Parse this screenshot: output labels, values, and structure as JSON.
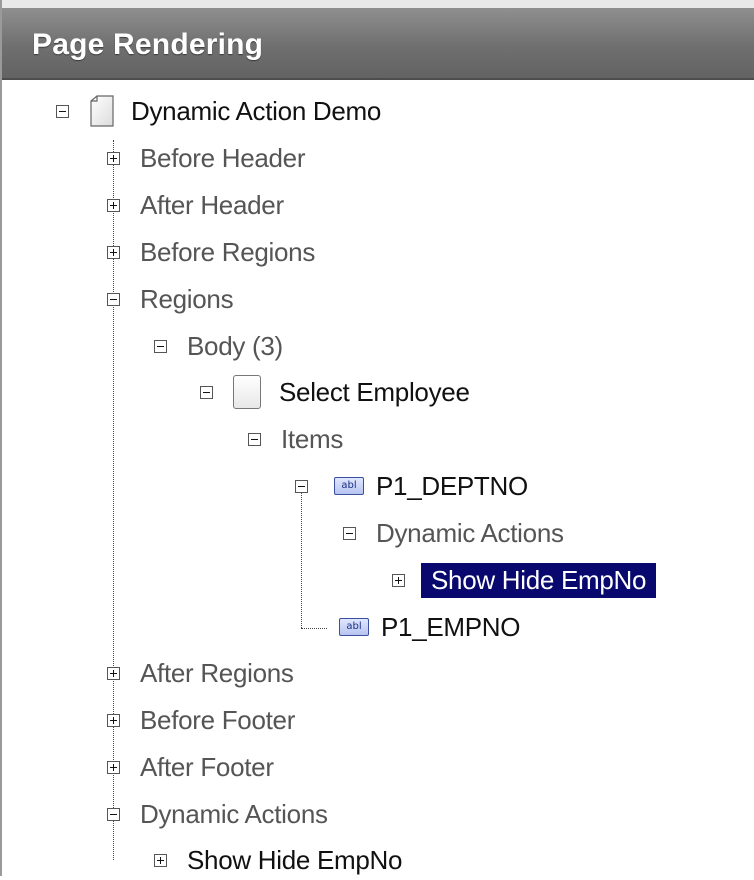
{
  "panel": {
    "title": "Page Rendering"
  },
  "tree": {
    "page": "Dynamic Action Demo",
    "before_header": "Before Header",
    "after_header": "After Header",
    "before_regions": "Before Regions",
    "regions": "Regions",
    "body": "Body (3)",
    "select_employee": "Select Employee",
    "items": "Items",
    "item_icon_text": "abl",
    "p1_deptno": "P1_DEPTNO",
    "item_dynamic_actions": "Dynamic Actions",
    "item_show_hide": "Show Hide EmpNo",
    "p1_empno": "P1_EMPNO",
    "after_regions": "After Regions",
    "before_footer": "Before Footer",
    "after_footer": "After Footer",
    "dynamic_actions": "Dynamic Actions",
    "show_hide": "Show Hide EmpNo"
  },
  "colors": {
    "header": "#6f6f6f",
    "selected": "#08086e",
    "label": "#555555"
  }
}
